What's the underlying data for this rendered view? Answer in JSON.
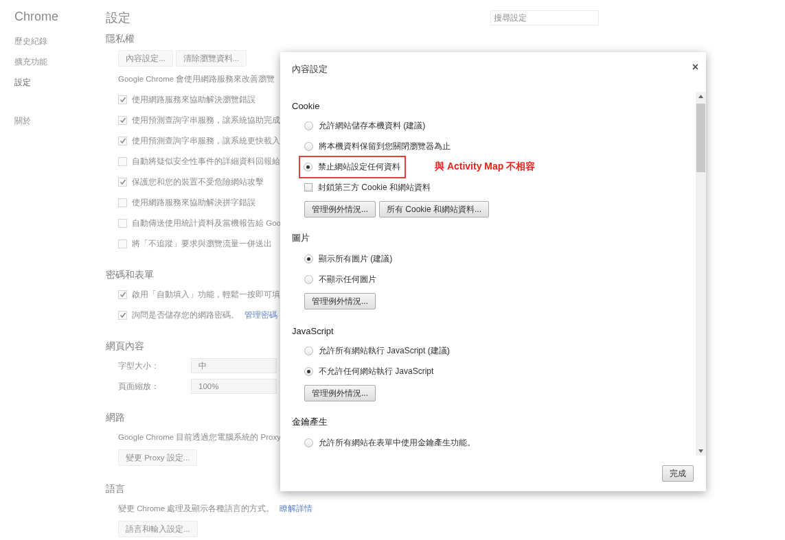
{
  "sidebar": {
    "title": "Chrome",
    "items": [
      {
        "label": "歷史紀錄",
        "selected": false
      },
      {
        "label": "擴充功能",
        "selected": false
      },
      {
        "label": "設定",
        "selected": true
      },
      {
        "label": "關於",
        "selected": false
      }
    ]
  },
  "page": {
    "title": "設定",
    "search": {
      "placeholder": "搜尋設定"
    },
    "sections": [
      {
        "title": "隱私權",
        "items": [
          {
            "kind": "buttons",
            "buttons": [
              "內容設定...",
              "清除瀏覽資料..."
            ]
          },
          {
            "kind": "text",
            "text": "Google Chrome 會使用網路服務來改善瀏覽"
          },
          {
            "kind": "checkbox",
            "label": "使用網路服務來協助解決瀏覽錯誤",
            "checked": true
          },
          {
            "kind": "checkbox",
            "label": "使用預測查詢字串服務，讓系統協助完成",
            "checked": true
          },
          {
            "kind": "checkbox",
            "label": "使用預測查詢字串服務，讓系統更快載入",
            "checked": true
          },
          {
            "kind": "checkbox",
            "label": "自動將疑似安全性事件的詳細資料回報給",
            "checked": false
          },
          {
            "kind": "checkbox",
            "label": "保護您和您的裝置不受危險網站攻擊",
            "checked": true
          },
          {
            "kind": "checkbox",
            "label": "使用網路服務來協助解決拼字錯誤",
            "checked": false
          },
          {
            "kind": "checkbox",
            "label": "自動傳送使用統計資料及當機報告給 Goo",
            "checked": false
          },
          {
            "kind": "checkbox",
            "label": "將「不追蹤」要求與瀏覽流量一併送出",
            "checked": false
          }
        ]
      },
      {
        "title": "密碼和表單",
        "items": [
          {
            "kind": "checkbox",
            "label": "啟用「自動填入」功能，輕鬆一按即可填",
            "checked": true
          },
          {
            "kind": "checkbox",
            "label": "詢問是否儲存您的網路密碼。",
            "link": "管理密碼",
            "checked": true
          }
        ]
      },
      {
        "title": "網頁內容",
        "items": [
          {
            "kind": "select",
            "label": "字型大小：",
            "value": "中"
          },
          {
            "kind": "select",
            "label": "頁面縮放：",
            "value": "100%"
          }
        ]
      },
      {
        "title": "網路",
        "items": [
          {
            "kind": "text",
            "text": "Google Chrome 目前透過您電腦系統的 Proxy"
          },
          {
            "kind": "buttons",
            "buttons": [
              "變更 Proxy 設定..."
            ]
          }
        ]
      },
      {
        "title": "語言",
        "items": [
          {
            "kind": "text",
            "text": "變更 Chrome 處理及顯示各種語言的方式。",
            "link": "瞭解詳情"
          },
          {
            "kind": "buttons",
            "buttons": [
              "語言和輸入設定..."
            ]
          }
        ]
      }
    ]
  },
  "dialog": {
    "title": "內容設定",
    "close": "×",
    "done": "完成",
    "sections": [
      {
        "title": "Cookie",
        "items": [
          {
            "kind": "radio",
            "label": "允許網站儲存本機資料 (建議)",
            "selected": false
          },
          {
            "kind": "radio",
            "label": "將本機資料保留到您關閉瀏覽器為止",
            "selected": false
          },
          {
            "kind": "radio",
            "label": "禁止網站設定任何資料",
            "selected": true,
            "annotation": "與 Activity Map 不相容"
          },
          {
            "kind": "checkbox",
            "label": "封鎖第三方 Cookie 和網站資料",
            "checked": false
          },
          {
            "kind": "buttons",
            "buttons": [
              "管理例外情況...",
              "所有 Cookie 和網站資料..."
            ]
          }
        ]
      },
      {
        "title": "圖片",
        "items": [
          {
            "kind": "radio",
            "label": "顯示所有圖片 (建議)",
            "selected": true
          },
          {
            "kind": "radio",
            "label": "不顯示任何圖片",
            "selected": false
          },
          {
            "kind": "buttons",
            "buttons": [
              "管理例外情況..."
            ]
          }
        ]
      },
      {
        "title": "JavaScript",
        "items": [
          {
            "kind": "radio",
            "label": "允許所有網站執行 JavaScript (建議)",
            "selected": false
          },
          {
            "kind": "radio",
            "label": "不允許任何網站執行 JavaScript",
            "selected": true
          },
          {
            "kind": "buttons",
            "buttons": [
              "管理例外情況..."
            ]
          }
        ]
      },
      {
        "title": "金鑰產生",
        "items": [
          {
            "kind": "radio",
            "label": "允許所有網站在表單中使用金鑰產生功能。",
            "selected": false
          }
        ]
      }
    ]
  }
}
